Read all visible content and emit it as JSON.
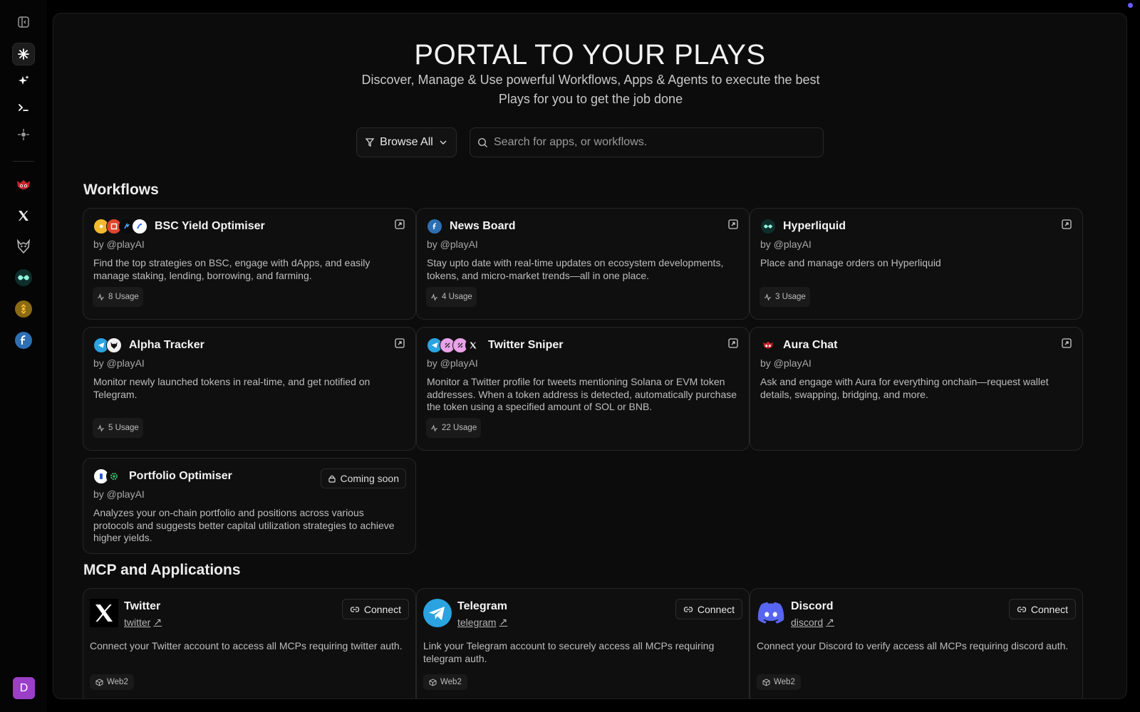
{
  "hero": {
    "title": "PORTAL TO YOUR PLAYS",
    "subtitle": "Discover, Manage & Use powerful Workflows, Apps & Agents to execute the best Plays for you to get the job done"
  },
  "toolbar": {
    "browse_label": "Browse All",
    "search_placeholder": "Search for apps, or workflows."
  },
  "sidebar": {
    "avatar_letter": "D",
    "items": [
      {
        "icon": "panel-toggle-icon"
      },
      {
        "icon": "asterisk-icon"
      },
      {
        "icon": "sparkles-icon"
      },
      {
        "icon": "terminal-icon"
      },
      {
        "icon": "crosshair-icon"
      },
      {
        "icon": "aura-mascot-icon"
      },
      {
        "icon": "x-logo-icon"
      },
      {
        "icon": "wolf-icon"
      },
      {
        "icon": "hyperliquid-icon"
      },
      {
        "icon": "binance-icon"
      },
      {
        "icon": "fuse-icon"
      }
    ]
  },
  "workflows": {
    "title": "Workflows",
    "cards": [
      {
        "title": "BSC Yield Optimiser",
        "author": "by @playAI",
        "desc": "Find the top strategies on BSC, engage with dApps, and easily manage staking, lending, borrowing, and farming.",
        "usage": "8 Usage"
      },
      {
        "title": "News Board",
        "author": "by @playAI",
        "desc": "Stay upto date with real-time updates on ecosystem developments, tokens, and micro-market trends—all in one place.",
        "usage": "4 Usage"
      },
      {
        "title": "Hyperliquid",
        "author": "by @playAI",
        "desc": "Place and manage orders on Hyperliquid",
        "usage": "3 Usage"
      },
      {
        "title": "Alpha Tracker",
        "author": "by @playAI",
        "desc": "Monitor newly launched tokens in real-time, and get notified on Telegram.",
        "usage": "5 Usage"
      },
      {
        "title": "Twitter Sniper",
        "author": "by @playAI",
        "desc": "Monitor a Twitter profile for tweets mentioning Solana or EVM token addresses. When a token address is detected, automatically purchase the token using a specified amount of SOL or BNB.",
        "usage": "22 Usage"
      },
      {
        "title": "Aura Chat",
        "author": "by @playAI",
        "desc": "Ask and engage with Aura for everything onchain—request wallet details, swapping, bridging, and more."
      },
      {
        "title": "Portfolio Optimiser",
        "author": "by @playAI",
        "desc": "Analyzes your on-chain portfolio and positions across various protocols and suggests better capital utilization strategies to achieve higher yields.",
        "badge": "Coming soon"
      }
    ]
  },
  "apps": {
    "title": "MCP and Applications",
    "cards": [
      {
        "title": "Twitter",
        "link": "twitter",
        "connect": "Connect",
        "desc": "Connect your Twitter account to access all MCPs requiring twitter auth.",
        "tag": "Web2"
      },
      {
        "title": "Telegram",
        "link": "telegram",
        "connect": "Connect",
        "desc": "Link your Telegram account to securely access all MCPs requiring telegram auth.",
        "tag": "Web2"
      },
      {
        "title": "Discord",
        "link": "discord",
        "connect": "Connect",
        "desc": "Connect your Discord to verify access all MCPs requiring discord auth.",
        "tag": "Web2"
      }
    ]
  },
  "colors": {
    "background": "#000000",
    "panel": "#0c0c0c",
    "card": "#0f0f0f",
    "telegram": "#2aa3e0",
    "discord": "#5865f2",
    "avatar": "#9b3fc9"
  }
}
